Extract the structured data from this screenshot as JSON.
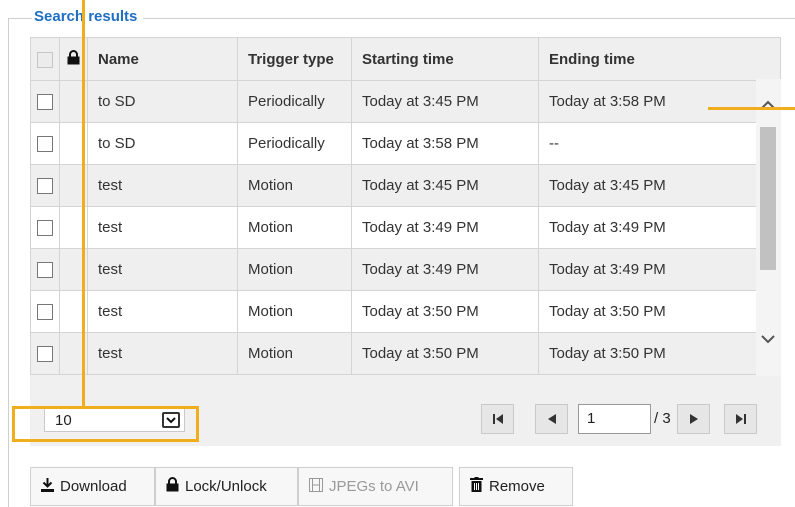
{
  "section": {
    "legend": "Search results"
  },
  "table": {
    "headers": {
      "name": "Name",
      "trigger": "Trigger type",
      "start": "Starting time",
      "end": "Ending time"
    },
    "rows": [
      {
        "name": "to SD",
        "trigger": "Periodically",
        "start": "Today at 3:45 PM",
        "end": "Today at 3:58 PM"
      },
      {
        "name": "to SD",
        "trigger": "Periodically",
        "start": "Today at 3:58 PM",
        "end": "--"
      },
      {
        "name": "test",
        "trigger": "Motion",
        "start": "Today at 3:45 PM",
        "end": "Today at 3:45 PM"
      },
      {
        "name": "test",
        "trigger": "Motion",
        "start": "Today at 3:49 PM",
        "end": "Today at 3:49 PM"
      },
      {
        "name": "test",
        "trigger": "Motion",
        "start": "Today at 3:49 PM",
        "end": "Today at 3:49 PM"
      },
      {
        "name": "test",
        "trigger": "Motion",
        "start": "Today at 3:50 PM",
        "end": "Today at 3:50 PM"
      },
      {
        "name": "test",
        "trigger": "Motion",
        "start": "Today at 3:50 PM",
        "end": "Today at 3:50 PM"
      }
    ]
  },
  "pager": {
    "page_size": "10",
    "current_page": "1",
    "total": "/ 3"
  },
  "buttons": {
    "download": "Download",
    "lock": "Lock/Unlock",
    "jpegs": "JPEGs to AVI",
    "remove": "Remove"
  },
  "colors": {
    "legend": "#1e6fc4",
    "annotation": "#f0ad1c"
  },
  "icons": {
    "header_lock": "lock-icon",
    "first": "first-page-icon",
    "prev": "prev-page-icon",
    "next": "next-page-icon",
    "last": "last-page-icon",
    "download": "download-icon",
    "lock_btn": "lock-icon",
    "film": "film-icon",
    "trash": "trash-icon"
  }
}
